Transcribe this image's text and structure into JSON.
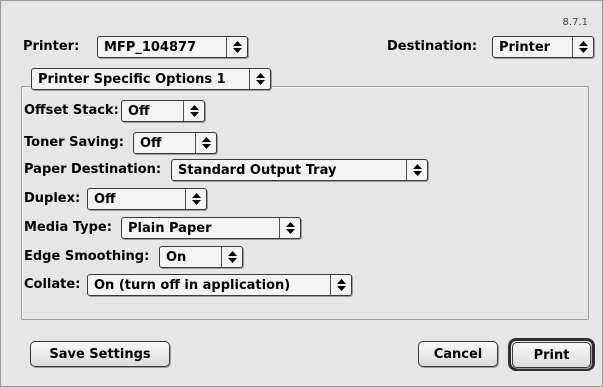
{
  "version": "8.7.1",
  "printer": {
    "label": "Printer:",
    "value": "MFP_104877"
  },
  "destination": {
    "label": "Destination:",
    "value": "Printer"
  },
  "panel_selector": {
    "value": "Printer Specific Options 1"
  },
  "options": [
    {
      "label": "Offset Stack:",
      "value": "Off"
    },
    {
      "label": "Toner Saving:",
      "value": "Off"
    },
    {
      "label": "Paper Destination:",
      "value": "Standard Output Tray"
    },
    {
      "label": "Duplex:",
      "value": "Off"
    },
    {
      "label": "Media Type:",
      "value": "Plain Paper"
    },
    {
      "label": "Edge Smoothing:",
      "value": "On"
    },
    {
      "label": "Collate:",
      "value": "On (turn off in application)"
    }
  ],
  "buttons": {
    "save_settings": "Save Settings",
    "cancel": "Cancel",
    "print": "Print"
  },
  "icons": {
    "popup_arrows": "up-down-arrows-icon"
  }
}
